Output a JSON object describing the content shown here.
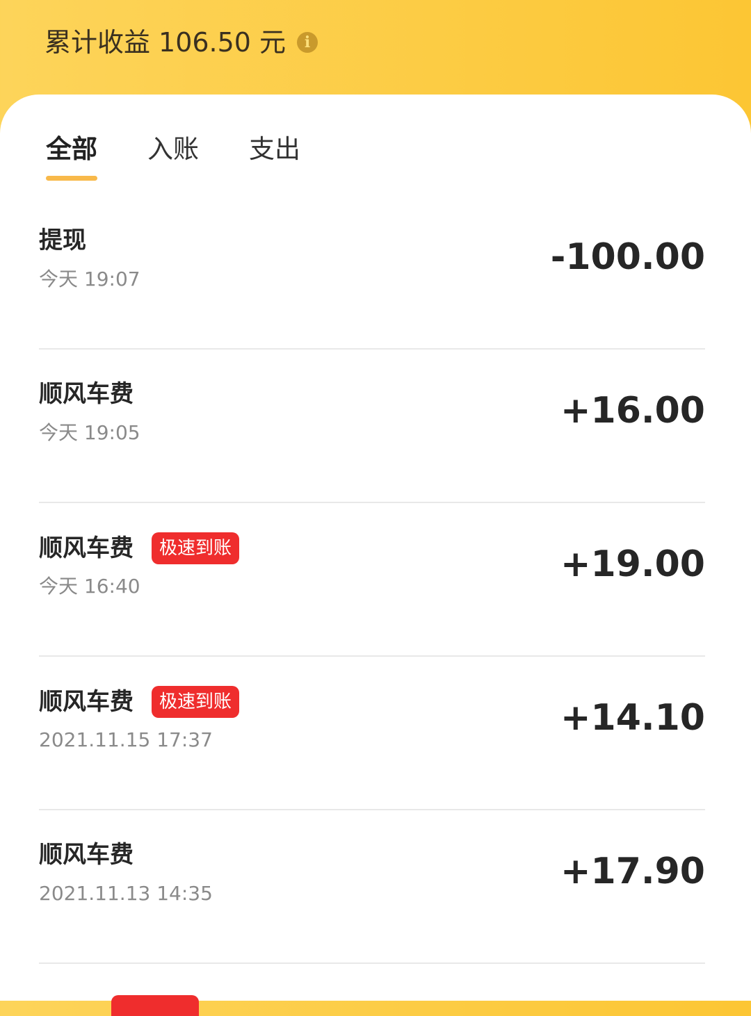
{
  "header": {
    "label": "累计收益",
    "amount": "106.50",
    "unit": "元",
    "info_icon": "info-icon",
    "bg_color_start": "#fdd45a",
    "bg_color_end": "#fcc634"
  },
  "tabs": [
    {
      "label": "全部",
      "active": true
    },
    {
      "label": "入账",
      "active": false
    },
    {
      "label": "支出",
      "active": false
    }
  ],
  "accent_color": "#f8b94a",
  "badge_color": "#ef2d2d",
  "transactions": [
    {
      "title": "提现",
      "badge": "",
      "time": "今天   19:07",
      "amount": "-100.00"
    },
    {
      "title": "顺风车费",
      "badge": "",
      "time": "今天   19:05",
      "amount": "+16.00"
    },
    {
      "title": "顺风车费",
      "badge": "极速到账",
      "time": "今天   16:40",
      "amount": "+19.00"
    },
    {
      "title": "顺风车费",
      "badge": "极速到账",
      "time": "2021.11.15 17:37",
      "amount": "+14.10"
    },
    {
      "title": "顺风车费",
      "badge": "",
      "time": "2021.11.13 14:35",
      "amount": "+17.90"
    }
  ]
}
